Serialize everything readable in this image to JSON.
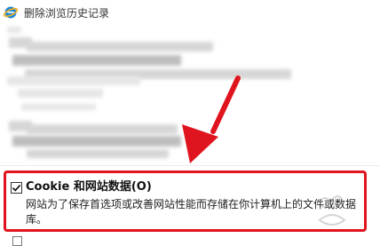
{
  "window": {
    "title": "删除浏览历史记录"
  },
  "cookies_option": {
    "checked": true,
    "label": "Cookie 和网站数据(O)",
    "description": "网站为了保存首选项或改善网站性能而存储在你计算机上的文件或数据库。"
  },
  "annotation": {
    "highlight_color": "#e0141e",
    "arrow_color": "#e0141e"
  },
  "icons": {
    "app": "internet-explorer-icon",
    "check": "checkmark-icon"
  }
}
